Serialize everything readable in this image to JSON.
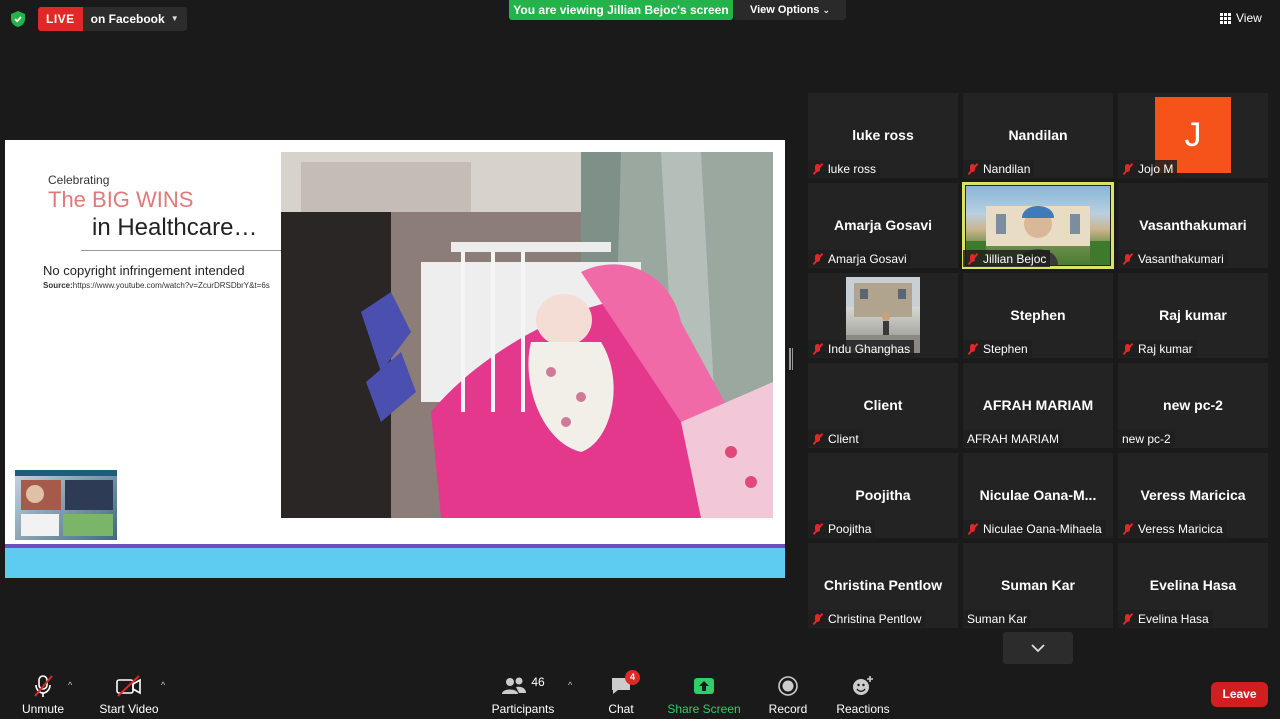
{
  "top": {
    "live_label": "LIVE",
    "live_destination": "on Facebook",
    "viewing_banner": "You are viewing Jillian Bejoc's screen",
    "view_options": "View Options",
    "view_label": "View"
  },
  "slide": {
    "celebrating": "Celebrating",
    "big_wins": "The BIG WINS",
    "healthcare": "in Healthcare…",
    "copyright": "No copyright infringement intended",
    "source_label": "Source:",
    "source_url": "https://www.youtube.com/watch?v=ZcurDRSDbrY&t=6s"
  },
  "tiles": [
    {
      "name": "luke ross",
      "label": "luke ross",
      "muted": true
    },
    {
      "name": "Nandilan",
      "label": "Nandilan",
      "muted": true
    },
    {
      "name": "",
      "label": "Jojo M",
      "muted": true,
      "avatar_letter": "J",
      "avatar_color": "#f5531a"
    },
    {
      "name": "Amarja Gosavi",
      "label": "Amarja Gosavi",
      "muted": true
    },
    {
      "name": "",
      "label": "Jillian Bejoc",
      "muted": true,
      "active_speaker": true
    },
    {
      "name": "Vasanthakumari",
      "label": "Vasanthakumari",
      "muted": true
    },
    {
      "name": "",
      "label": "Indu Ghanghas",
      "muted": true
    },
    {
      "name": "Stephen",
      "label": "Stephen",
      "muted": true
    },
    {
      "name": "Raj kumar",
      "label": "Raj kumar",
      "muted": true
    },
    {
      "name": "Client",
      "label": "Client",
      "muted": true
    },
    {
      "name": "AFRAH MARIAM",
      "label": "AFRAH MARIAM",
      "muted": false
    },
    {
      "name": "new pc-2",
      "label": "new pc-2",
      "muted": false
    },
    {
      "name": "Poojitha",
      "label": "Poojitha",
      "muted": true
    },
    {
      "name": "Niculae  Oana-M...",
      "label": "Niculae Oana-Mihaela",
      "muted": true
    },
    {
      "name": "Veress Maricica",
      "label": "Veress Maricica",
      "muted": true
    },
    {
      "name": "Christina Pentlow",
      "label": "Christina Pentlow",
      "muted": true
    },
    {
      "name": "Suman Kar",
      "label": "Suman Kar",
      "muted": false
    },
    {
      "name": "Evelina Hasa",
      "label": "Evelina Hasa",
      "muted": true
    }
  ],
  "toolbar": {
    "unmute": "Unmute",
    "start_video": "Start Video",
    "participants": "Participants",
    "participants_count": "46",
    "chat": "Chat",
    "chat_badge": "4",
    "share_screen": "Share Screen",
    "record": "Record",
    "reactions": "Reactions",
    "leave": "Leave"
  },
  "colors": {
    "live_red": "#e02828",
    "banner_green": "#23b34a",
    "share_green": "#2ecf6a",
    "active_speaker": "#d9e463",
    "leave_red": "#d11f1f"
  }
}
